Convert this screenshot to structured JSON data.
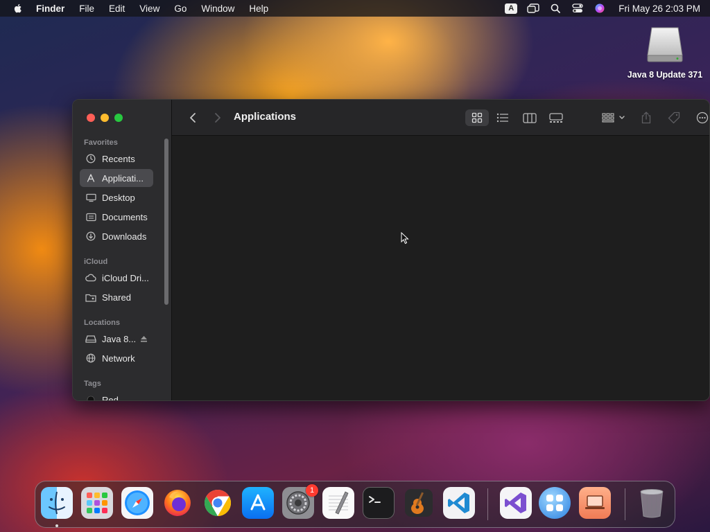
{
  "menubar": {
    "app_name": "Finder",
    "menus": [
      "File",
      "Edit",
      "View",
      "Go",
      "Window",
      "Help"
    ],
    "input_badge": "A",
    "clock": "Fri May 26  2:03 PM"
  },
  "desktop": {
    "drive_label": "Java 8 Update 371"
  },
  "finder": {
    "title": "Applications",
    "sidebar": {
      "favorites_label": "Favorites",
      "favorites": [
        {
          "label": "Recents",
          "icon": "clock-icon"
        },
        {
          "label": "Applicati...",
          "icon": "apps-icon",
          "selected": true
        },
        {
          "label": "Desktop",
          "icon": "desktop-icon"
        },
        {
          "label": "Documents",
          "icon": "document-icon"
        },
        {
          "label": "Downloads",
          "icon": "download-icon"
        }
      ],
      "icloud_label": "iCloud",
      "icloud": [
        {
          "label": "iCloud Dri...",
          "icon": "cloud-icon"
        },
        {
          "label": "Shared",
          "icon": "shared-folder-icon"
        }
      ],
      "locations_label": "Locations",
      "locations": [
        {
          "label": "Java 8...",
          "icon": "drive-icon"
        },
        {
          "label": "Network",
          "icon": "globe-icon"
        }
      ],
      "tags_label": "Tags",
      "tags": [
        {
          "label": "Red",
          "color": "#ff3b30"
        }
      ]
    }
  },
  "dock": {
    "settings_badge": "1",
    "apps": [
      "Finder",
      "Launchpad",
      "Safari",
      "Firefox",
      "Chrome",
      "App Store",
      "System Settings",
      "TextEdit",
      "Terminal",
      "GarageBand",
      "Visual Studio Code",
      "Visual Studio",
      "Some App",
      "Remote Desktop",
      "Trash"
    ]
  },
  "colors": {
    "accent": "#0a84ff",
    "sidebar_selected": "#4a4a4e",
    "window_bg": "#1e1e1e"
  }
}
